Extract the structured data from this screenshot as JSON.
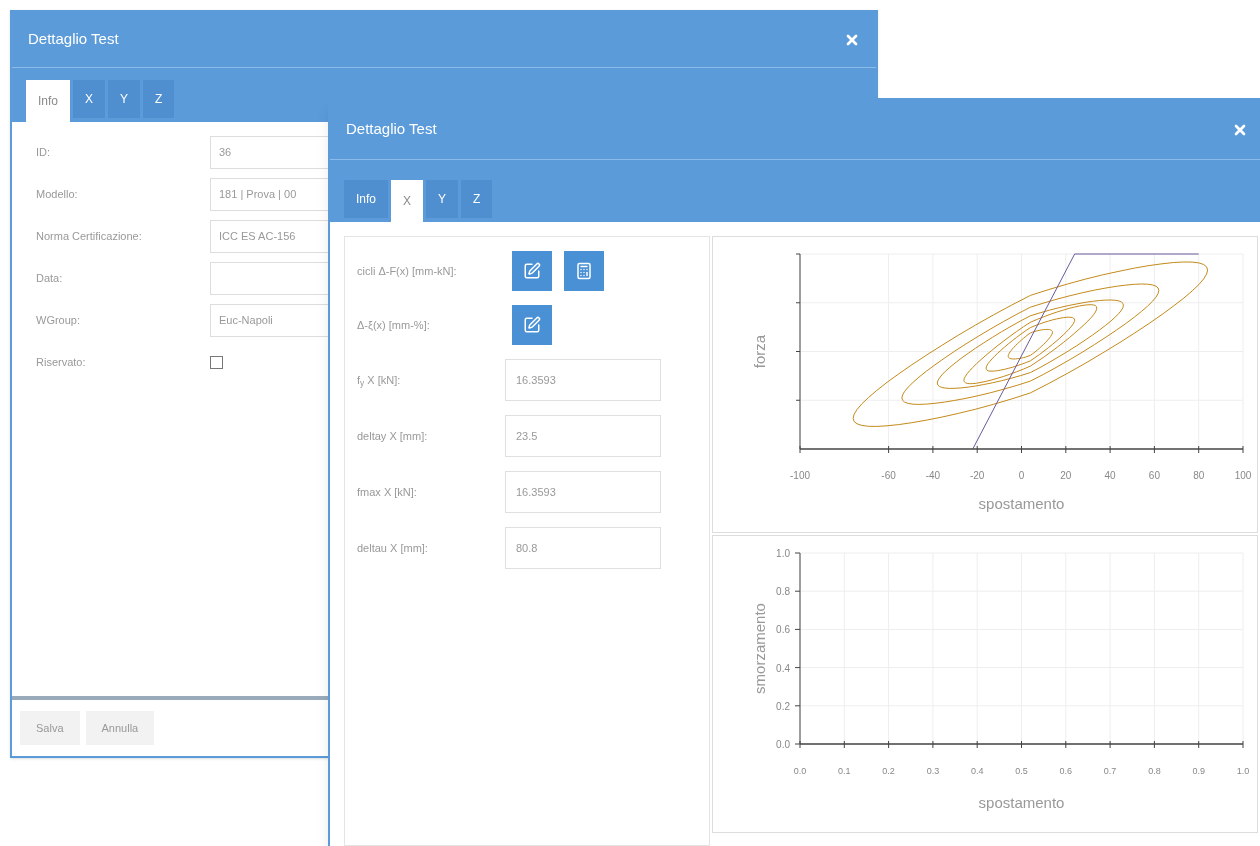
{
  "back_window": {
    "title": "Dettaglio Test",
    "tabs": [
      {
        "label": "Info",
        "selected": true
      },
      {
        "label": "X",
        "selected": false
      },
      {
        "label": "Y",
        "selected": false
      },
      {
        "label": "Z",
        "selected": false
      }
    ],
    "fields": [
      {
        "kind": "text",
        "label": "ID:",
        "value": "36"
      },
      {
        "kind": "text",
        "label": "Modello:",
        "value": "181 | Prova | 00"
      },
      {
        "kind": "text",
        "label": "Norma Certificazione:",
        "value": "ICC ES AC-156"
      },
      {
        "kind": "text",
        "label": "Data:"
      },
      {
        "kind": "text",
        "label": "WGroup:",
        "value": "Euc-Napoli"
      },
      {
        "kind": "checkbox",
        "label": "Riservato:",
        "checked": false
      }
    ],
    "buttons": [
      "Salva",
      "Annulla"
    ]
  },
  "front_window": {
    "title": "Dettaglio Test",
    "tabs": [
      {
        "label": "Info",
        "selected": false
      },
      {
        "label": "X",
        "selected": true
      },
      {
        "label": "Y",
        "selected": false
      },
      {
        "label": "Z",
        "selected": false
      }
    ],
    "actions": [
      {
        "label": "cicli Δ-F(x) [mm-kN]:",
        "icons": [
          {
            "kind": "edit"
          },
          {
            "kind": "calculator"
          }
        ]
      },
      {
        "label": "Δ-ξ(x) [mm-%]:",
        "icons": [
          {
            "kind": "edit"
          }
        ]
      }
    ],
    "fields": [
      {
        "label": "f$_{y}$ X [kN]:",
        "value": "16.3593"
      },
      {
        "label": "deltay X [mm]:",
        "value": "23.5"
      },
      {
        "label": "fmax X [kN]:",
        "value": "16.3593"
      },
      {
        "label": "deltau X [mm]:",
        "value": "80.8"
      }
    ],
    "hysteresis_chart": {
      "xlabel": "spostamento",
      "ylabel": "forza",
      "xticks": [
        "-100",
        "-60",
        "-40",
        "-20",
        "0",
        "20",
        "40",
        "60",
        "80",
        "100"
      ]
    },
    "damping_chart": {
      "xlabel": "spostamento",
      "ylabel": "smorzamento",
      "xticks": [
        "0.0",
        "0.1",
        "0.2",
        "0.3",
        "0.4",
        "0.5",
        "0.6",
        "0.7",
        "0.8",
        "0.9",
        "1.0"
      ],
      "yticks": [
        "1.0",
        "0.8",
        "0.6",
        "0.4",
        "0.2",
        "0.0"
      ]
    }
  }
}
